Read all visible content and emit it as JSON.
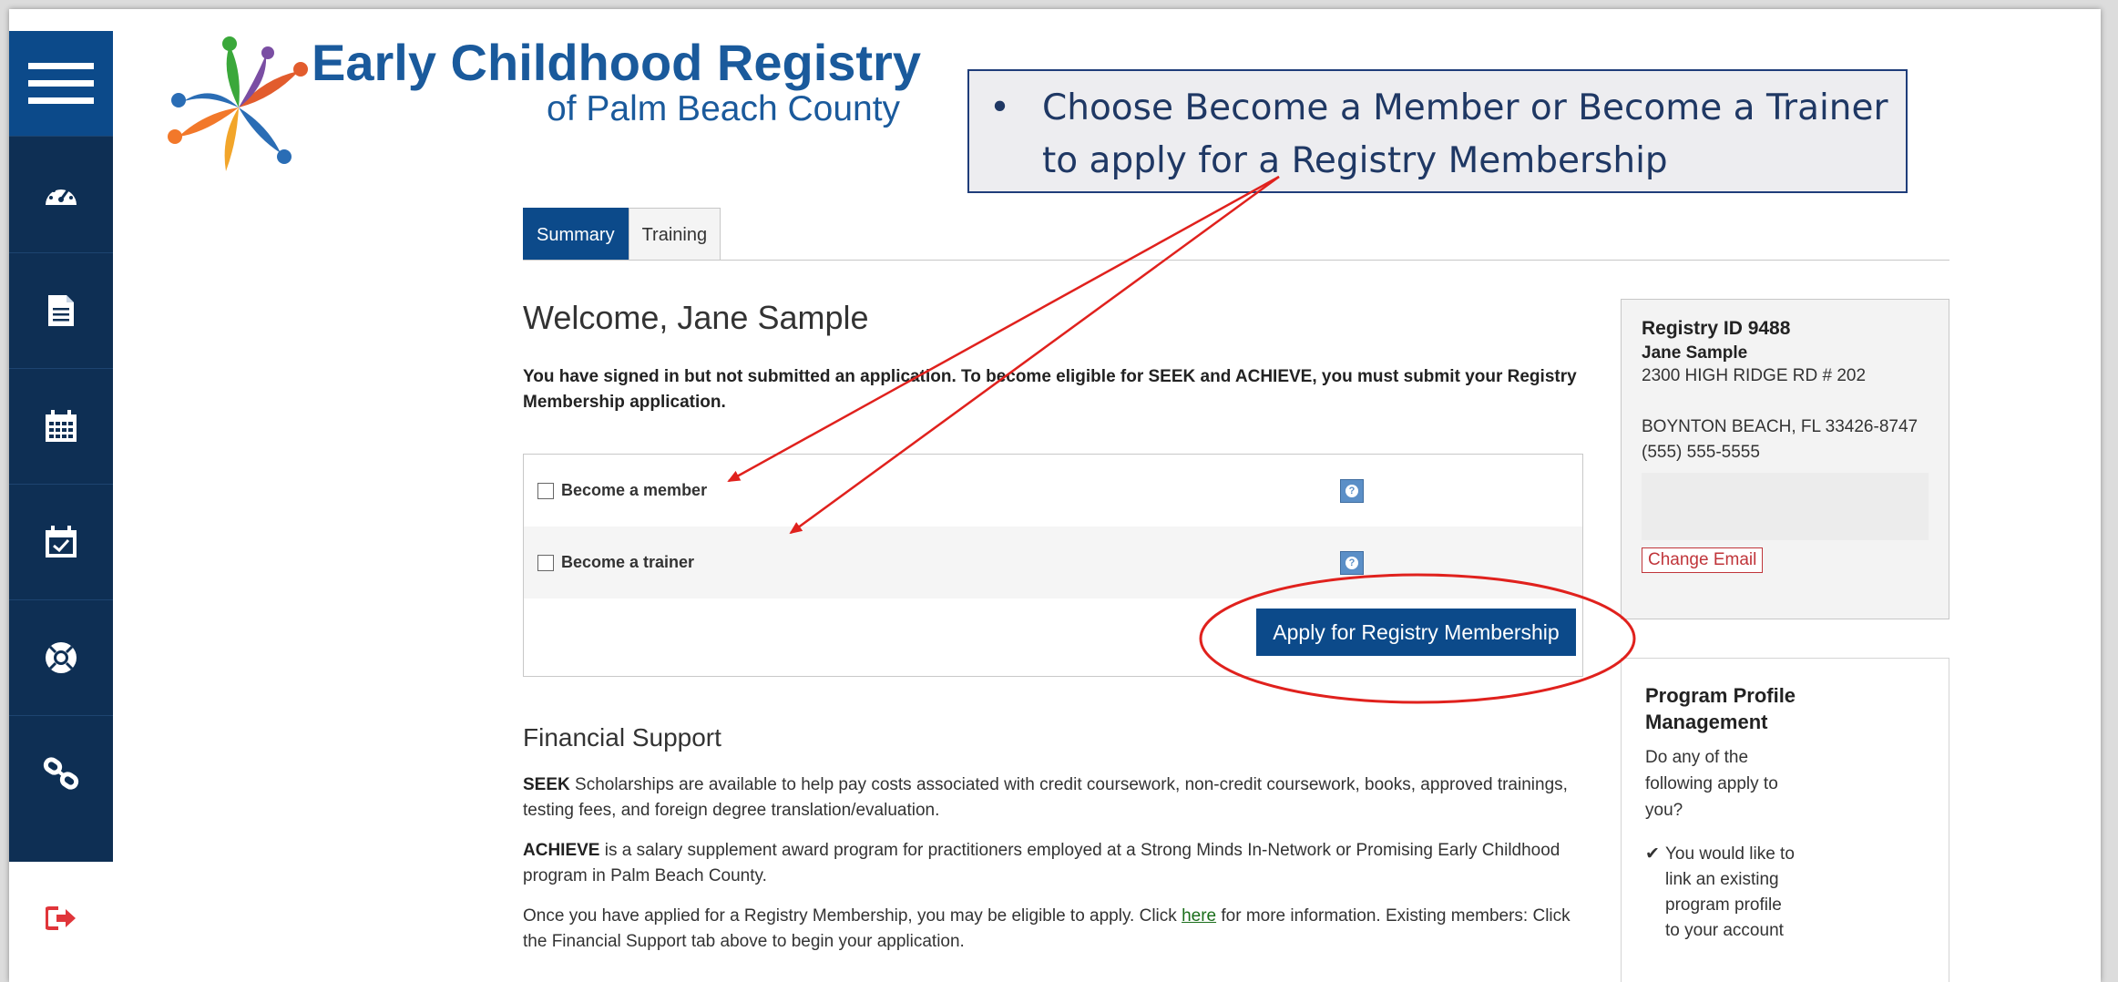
{
  "logo": {
    "title": "Early Childhood Registry",
    "subtitle": "of Palm Beach County",
    "colors": [
      "#2a6db5",
      "#e25c2d",
      "#3aa83a",
      "#7a4ea3",
      "#f2a52a"
    ]
  },
  "sidebar": {
    "items": [
      {
        "icon": "menu-icon"
      },
      {
        "icon": "dashboard-icon"
      },
      {
        "icon": "document-icon"
      },
      {
        "icon": "calendar-icon"
      },
      {
        "icon": "calendar-check-icon"
      },
      {
        "icon": "support-lifebuoy-icon"
      },
      {
        "icon": "link-icon"
      },
      {
        "icon": "logout-icon"
      }
    ]
  },
  "callout": {
    "bullet": "•",
    "text": "Choose Become a Member or Become a Trainer to apply for a Registry Membership"
  },
  "tabs": [
    {
      "label": "Summary",
      "active": true
    },
    {
      "label": "Training",
      "active": false
    }
  ],
  "welcome": "Welcome, Jane Sample",
  "notice": "You have signed in but not submitted an application. To become eligible for SEEK and ACHIEVE, you must submit your Registry Membership application.",
  "options": [
    {
      "label": "Become a member",
      "checked": false
    },
    {
      "label": "Become a trainer",
      "checked": false
    }
  ],
  "apply_button": "Apply for Registry Membership",
  "financial": {
    "title": "Financial Support",
    "seek_lead": "SEEK",
    "seek_text": " Scholarships are available to help pay costs associated with credit coursework, non-credit coursework, books, approved trainings, testing fees, and foreign degree translation/evaluation.",
    "achieve_lead": "ACHIEVE",
    "achieve_text": " is a salary supplement award program for practitioners employed at a Strong Minds In-Network or Promising Early Childhood program in Palm Beach County.",
    "once_text_1": "Once you have applied for a Registry Membership, you may be eligible to apply. Click ",
    "once_link": "here",
    "once_text_2": " for more information. Existing members: Click the Financial Support tab above to begin your application."
  },
  "profile": {
    "registry_id": "Registry ID 9488",
    "name": "Jane Sample",
    "address1": "2300 HIGH RIDGE RD # 202",
    "city_state_zip": "BOYNTON BEACH, FL 33426-8747",
    "phone": "(555) 555-5555",
    "change_email": "Change Email"
  },
  "program_profile": {
    "title": "Program Profile Management",
    "question": "Do any of the following apply to you?",
    "items": [
      {
        "check": "✔",
        "text": "You would like to link an existing program profile to your account"
      }
    ]
  },
  "annotation_colors": {
    "arrow": "#e0211d",
    "ellipse": "#e0211d",
    "callout_border": "#1f3d7a"
  }
}
